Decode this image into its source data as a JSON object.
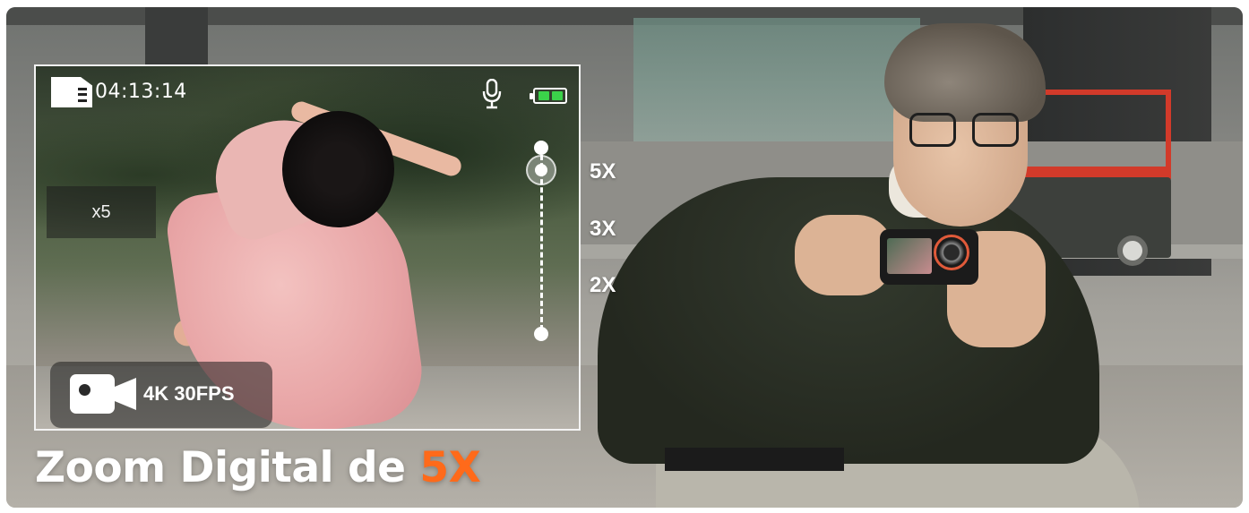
{
  "viewfinder": {
    "recording_time": "04:13:14",
    "zoom_indicator": "x5",
    "video_mode": "4K 30FPS",
    "battery_level": "full",
    "icons": {
      "storage": "sd-card-icon",
      "audio": "microphone-icon",
      "battery": "battery-icon",
      "video": "video-camera-icon"
    },
    "battery_color": "#3bd24a"
  },
  "zoom_levels": [
    "5X",
    "3X",
    "2X"
  ],
  "selected_zoom": "5X",
  "headline": {
    "prefix": "Zoom Digital de ",
    "accent": "5X",
    "accent_color": "#ff6a1a"
  }
}
